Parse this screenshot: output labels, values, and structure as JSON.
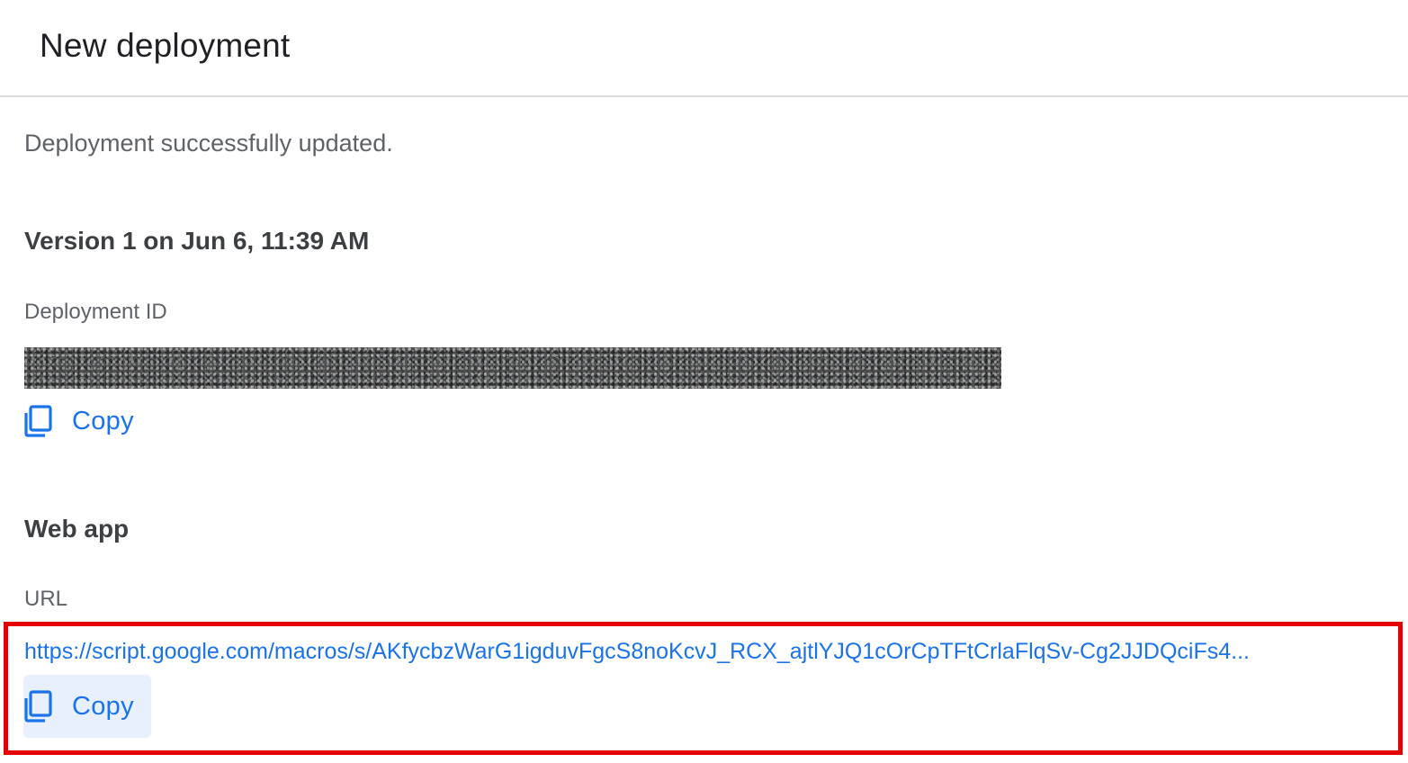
{
  "dialog": {
    "title": "New deployment",
    "status_message": "Deployment successfully updated.",
    "version_heading": "Version 1 on Jun 6, 11:39 AM",
    "deployment_id": {
      "label": "Deployment ID",
      "copy_label": "Copy",
      "copy_icon": "copy-icon"
    },
    "web_app": {
      "heading": "Web app",
      "url_label": "URL",
      "url": "https://script.google.com/macros/s/AKfycbzWarG1igduvFgcS8noKcvJ_RCX_ajtlYJQ1cOrCpTFtCrlaFlqSv-Cg2JJDQciFs4...",
      "copy_label": "Copy",
      "copy_icon": "copy-icon"
    }
  },
  "colors": {
    "link": "#1a73e8",
    "highlight_border": "#e50000",
    "active_button_bg": "#e8f0fe"
  }
}
